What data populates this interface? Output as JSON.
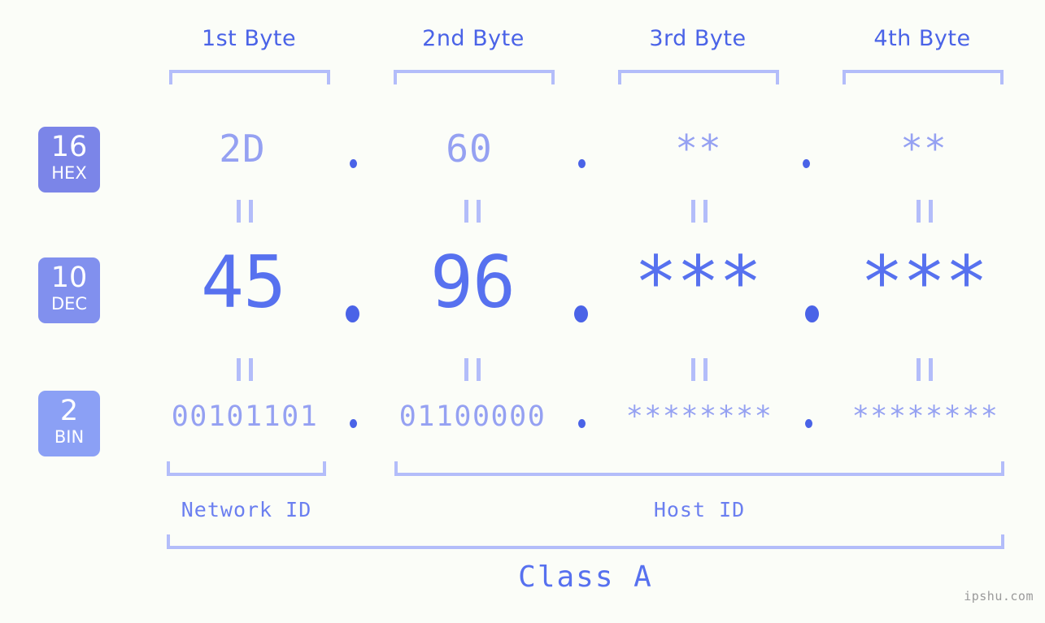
{
  "meta": {
    "background_color": "#fbfdf8",
    "accent_strong": "#4a63e7",
    "accent_mid": "#5771ef",
    "accent_light": "#95a1f2",
    "bracket_color": "#b3bdfa",
    "separator": ".",
    "watermark": "ipshu.com"
  },
  "headers": [
    {
      "label": "1st Byte"
    },
    {
      "label": "2nd Byte"
    },
    {
      "label": "3rd Byte"
    },
    {
      "label": "4th Byte"
    }
  ],
  "bases": [
    {
      "number": "16",
      "name": "HEX",
      "color": "#7b85e8"
    },
    {
      "number": "10",
      "name": "DEC",
      "color": "#8190ee"
    },
    {
      "number": "2",
      "name": "BIN",
      "color": "#8ba0f5"
    }
  ],
  "rows": {
    "hex": {
      "base": "16",
      "base_name": "HEX",
      "values": [
        "2D",
        "60",
        "**",
        "**"
      ]
    },
    "dec": {
      "base": "10",
      "base_name": "DEC",
      "values": [
        "45",
        "96",
        "***",
        "***"
      ]
    },
    "bin": {
      "base": "2",
      "base_name": "BIN",
      "values": [
        "00101101",
        "01100000",
        "********",
        "********"
      ]
    }
  },
  "equals_symbol": "=",
  "segments": [
    {
      "label": "Network ID"
    },
    {
      "label": "Host ID"
    }
  ],
  "class": {
    "label": "Class A"
  }
}
